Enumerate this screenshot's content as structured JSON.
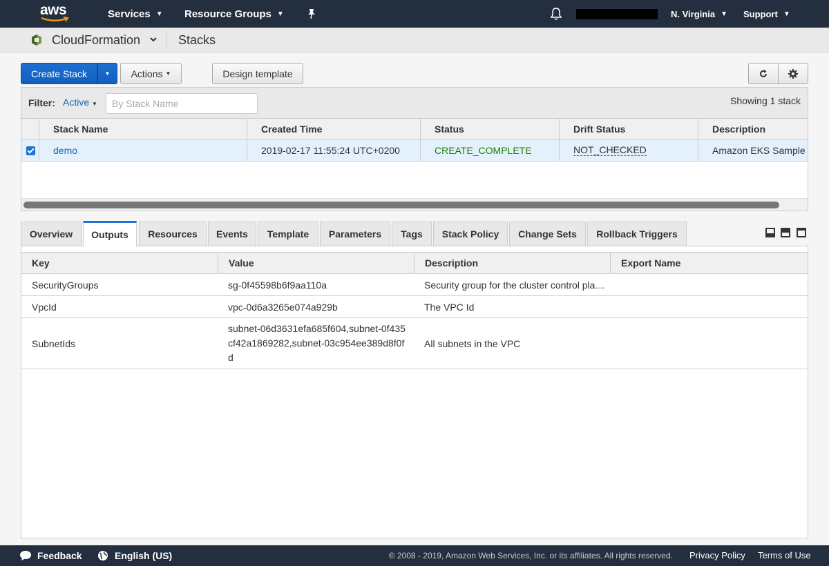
{
  "topnav": {
    "logo_text": "aws",
    "services_label": "Services",
    "resource_groups_label": "Resource Groups",
    "region_label": "N. Virginia",
    "support_label": "Support"
  },
  "servicebar": {
    "service_name": "CloudFormation",
    "page_title": "Stacks"
  },
  "toolbar": {
    "create_stack_label": "Create Stack",
    "actions_label": "Actions",
    "design_template_label": "Design template"
  },
  "filter": {
    "label": "Filter:",
    "selected": "Active",
    "placeholder": "By Stack Name",
    "showing_text": "Showing 1 stack"
  },
  "stacks_table": {
    "columns": [
      "Stack Name",
      "Created Time",
      "Status",
      "Drift Status",
      "Description"
    ],
    "rows": [
      {
        "selected": true,
        "stack_name": "demo",
        "created_time": "2019-02-17 11:55:24 UTC+0200",
        "status": "CREATE_COMPLETE",
        "drift_status": "NOT_CHECKED",
        "description": "Amazon EKS Sample VPC"
      }
    ]
  },
  "tabs": [
    {
      "label": "Overview",
      "active": false
    },
    {
      "label": "Outputs",
      "active": true
    },
    {
      "label": "Resources",
      "active": false
    },
    {
      "label": "Events",
      "active": false
    },
    {
      "label": "Template",
      "active": false
    },
    {
      "label": "Parameters",
      "active": false
    },
    {
      "label": "Tags",
      "active": false
    },
    {
      "label": "Stack Policy",
      "active": false
    },
    {
      "label": "Change Sets",
      "active": false
    },
    {
      "label": "Rollback Triggers",
      "active": false
    }
  ],
  "outputs_table": {
    "columns": [
      "Key",
      "Value",
      "Description",
      "Export Name"
    ],
    "rows": [
      {
        "key": "SecurityGroups",
        "value": "sg-0f45598b6f9aa110a",
        "description": "Security group for the cluster control plane communication with worker nodes",
        "export_name": ""
      },
      {
        "key": "VpcId",
        "value": "vpc-0d6a3265e074a929b",
        "description": "The VPC Id",
        "export_name": ""
      },
      {
        "key": "SubnetIds",
        "value": "subnet-06d3631efa685f604,subnet-0f435cf42a1869282,subnet-03c954ee389d8f0fd",
        "description": "All subnets in the VPC",
        "export_name": ""
      }
    ]
  },
  "footer": {
    "feedback_label": "Feedback",
    "language_label": "English (US)",
    "copyright": "© 2008 - 2019, Amazon Web Services, Inc. or its affiliates. All rights reserved.",
    "privacy_label": "Privacy Policy",
    "terms_label": "Terms of Use"
  },
  "colors": {
    "nav_bg": "#232f3e",
    "primary_button": "#1b73d3",
    "link": "#1466b8",
    "status_green": "#1d8102",
    "selected_row": "#e4f0fb"
  }
}
